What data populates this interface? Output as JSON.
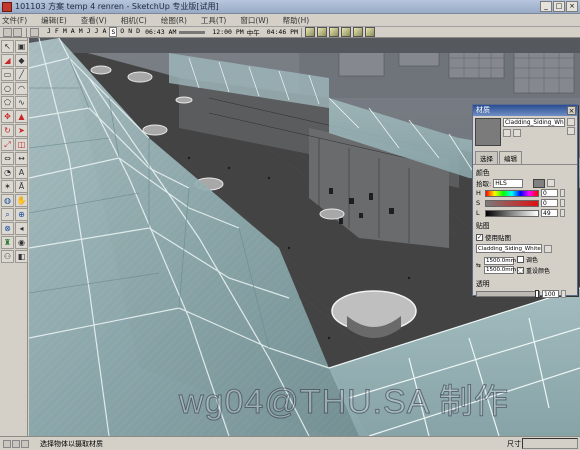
{
  "window": {
    "title": "101103 方案 temp 4 renren - SketchUp 专业版[试用]",
    "min": "_",
    "max": "□",
    "close": "×"
  },
  "menu": [
    "文件(F)",
    "编辑(E)",
    "查看(V)",
    "相机(C)",
    "绘图(R)",
    "工具(T)",
    "窗口(W)",
    "帮助(H)"
  ],
  "toolbar": {
    "months": [
      "J",
      "F",
      "M",
      "A",
      "M",
      "J",
      "J",
      "A",
      "S",
      "O",
      "N",
      "D"
    ],
    "active_month_index": 8,
    "time_left": "06:43 AM",
    "time_mid": "12:00 PM",
    "time_right": "04:46 PM",
    "mid_label": "中午"
  },
  "viewport": {
    "watermark": "wg04@THU.SA 制作"
  },
  "material_panel": {
    "title": "材质",
    "close": "×",
    "material_name": "Cladding_Siding_White",
    "swatch_color": "#7b7b7b",
    "tabs": [
      "选择",
      "编辑"
    ],
    "active_tab_index": 1,
    "color_section": "颜色",
    "picker_label": "拾取:",
    "picker_value": "HLS",
    "sliders": [
      {
        "label": "H",
        "value": "0"
      },
      {
        "label": "S",
        "value": "0"
      },
      {
        "label": "L",
        "value": "49"
      }
    ],
    "texture_section": "贴图",
    "use_texture_label": "使用贴图",
    "texture_file": "Cladding_Siding_White.jpg",
    "width": "1500.0mm",
    "height": "1500.0mm",
    "colorize_label": "调色",
    "reset_color_label": "重设颜色",
    "opacity_section": "透明",
    "opacity_value": "100"
  },
  "statusbar": {
    "message": "选择物体以摄取材质",
    "measure_label": "尺寸"
  }
}
